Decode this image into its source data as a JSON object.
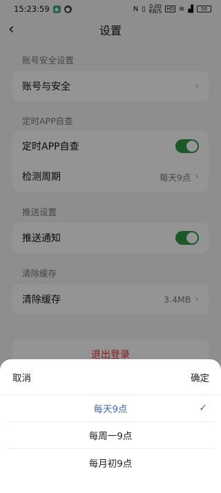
{
  "status_bar": {
    "time": "15:23:59",
    "net_speed_value": "0.00",
    "net_speed_unit": "KB/S",
    "hd_label": "HD",
    "battery": "50"
  },
  "nav": {
    "title": "设置"
  },
  "sections": {
    "account": {
      "label": "账号安全设置",
      "row_label": "账号与安全"
    },
    "self_check": {
      "label": "定时APP自查",
      "toggle_label": "定时APP自查",
      "toggle_on": true,
      "period_label": "检测周期",
      "period_value": "每天9点"
    },
    "push": {
      "label": "推送设置",
      "toggle_label": "推送通知",
      "toggle_on": true
    },
    "cache": {
      "label": "清除缓存",
      "row_label": "清除缓存",
      "size": "3.4MB"
    }
  },
  "logout": {
    "label": "退出登录"
  },
  "sheet": {
    "cancel": "取消",
    "confirm": "确定",
    "options": [
      {
        "label": "每天9点",
        "selected": true
      },
      {
        "label": "每周一9点",
        "selected": false
      },
      {
        "label": "每月初9点",
        "selected": false
      }
    ]
  },
  "colors": {
    "accent": "#3b66d6",
    "toggle_on": "#2d9c45",
    "danger": "#e03030"
  }
}
